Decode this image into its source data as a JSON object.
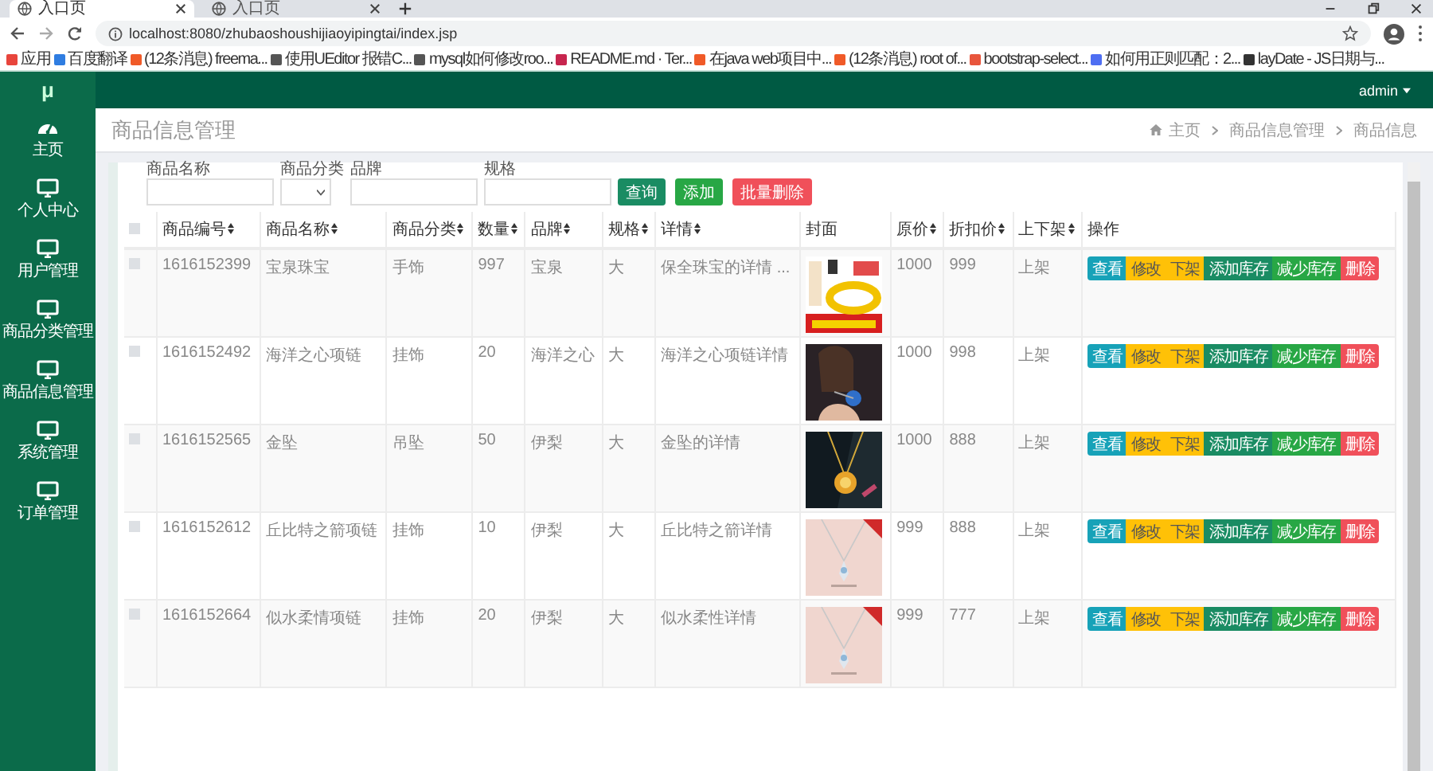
{
  "browser": {
    "tabs": [
      {
        "title": "入口页",
        "selected": true
      },
      {
        "title": "入口页",
        "selected": false
      }
    ],
    "url": "localhost:8080/zhubaoshoushijiaoyipingtai/index.jsp",
    "bookmarks": [
      {
        "label": "应用",
        "color": "#e8453c"
      },
      {
        "label": "百度翻译",
        "color": "#2f7de1"
      },
      {
        "label": "(12条消息) freema...",
        "color": "#f05a28"
      },
      {
        "label": "使用UEditor 报错C...",
        "color": "#555555"
      },
      {
        "label": "mysql如何修改roo...",
        "color": "#555555"
      },
      {
        "label": "README.md · Ter...",
        "color": "#c7254e"
      },
      {
        "label": "在java web项目中...",
        "color": "#f05a28"
      },
      {
        "label": "(12条消息) root of...",
        "color": "#f05a28"
      },
      {
        "label": "bootstrap-select...",
        "color": "#e8553c"
      },
      {
        "label": "如何用正则匹配：2...",
        "color": "#4e6ef2"
      },
      {
        "label": "layDate - JS日期与...",
        "color": "#333333"
      }
    ]
  },
  "app": {
    "logo": "μ",
    "user": "admin",
    "sidebar": [
      {
        "label": "主页",
        "kind": "gauge"
      },
      {
        "label": "个人中心",
        "kind": "monitor"
      },
      {
        "label": "用户管理",
        "kind": "monitor"
      },
      {
        "label": "商品分类管理",
        "kind": "monitor"
      },
      {
        "label": "商品信息管理",
        "kind": "monitor"
      },
      {
        "label": "系统管理",
        "kind": "monitor"
      },
      {
        "label": "订单管理",
        "kind": "monitor"
      }
    ],
    "page_title": "商品信息管理",
    "breadcrumb": [
      "主页",
      "商品信息管理",
      "商品信息"
    ],
    "filters": [
      {
        "label": "商品名称",
        "kind": "input"
      },
      {
        "label": "商品分类",
        "kind": "select"
      },
      {
        "label": "品牌",
        "kind": "input"
      },
      {
        "label": "规格",
        "kind": "input"
      }
    ],
    "filter_buttons": [
      {
        "label": "查询",
        "kind": "query"
      },
      {
        "label": "添加",
        "kind": "add"
      },
      {
        "label": "批量删除",
        "kind": "delete"
      }
    ],
    "table": {
      "select_all_checked": false,
      "columns": [
        {
          "label": "商品编号",
          "sortable": true
        },
        {
          "label": "商品名称",
          "sortable": true
        },
        {
          "label": "商品分类",
          "sortable": true
        },
        {
          "label": "数量",
          "sortable": true
        },
        {
          "label": "品牌",
          "sortable": true
        },
        {
          "label": "规格",
          "sortable": true
        },
        {
          "label": "详情",
          "sortable": true
        },
        {
          "label": "封面",
          "sortable": false
        },
        {
          "label": "原价",
          "sortable": true
        },
        {
          "label": "折扣价",
          "sortable": true
        },
        {
          "label": "上下架",
          "sortable": true
        },
        {
          "label": "操作",
          "sortable": false
        }
      ],
      "rows": [
        {
          "checked": false,
          "cells": [
            "1616152399",
            "宝泉珠宝",
            "手饰",
            "997",
            "宝泉",
            "大",
            "保全珠宝的详情 ..."
          ],
          "cover": {
            "kind": "picture"
          },
          "prices": [
            "1000",
            "999",
            "上架"
          ],
          "actions": [
            "查看",
            "修改",
            "下架",
            "添加库存",
            "减少库存",
            "删除"
          ]
        },
        {
          "checked": false,
          "cells": [
            "1616152492",
            "海洋之心项链",
            "挂饰",
            "20",
            "海洋之心",
            "大",
            "海洋之心项链详情"
          ],
          "cover": {
            "kind": "picture"
          },
          "prices": [
            "1000",
            "998",
            "上架"
          ],
          "actions": [
            "查看",
            "修改",
            "下架",
            "添加库存",
            "减少库存",
            "删除"
          ]
        },
        {
          "checked": false,
          "cells": [
            "1616152565",
            "金坠",
            "吊坠",
            "50",
            "伊梨",
            "大",
            "金坠的详情"
          ],
          "cover": {
            "kind": "picture"
          },
          "prices": [
            "1000",
            "888",
            "上架"
          ],
          "actions": [
            "查看",
            "修改",
            "下架",
            "添加库存",
            "减少库存",
            "删除"
          ]
        },
        {
          "checked": false,
          "cells": [
            "1616152612",
            "丘比特之箭项链",
            "挂饰",
            "10",
            "伊梨",
            "大",
            "丘比特之箭详情"
          ],
          "cover": {
            "kind": "picture"
          },
          "prices": [
            "999",
            "888",
            "上架"
          ],
          "actions": [
            "查看",
            "修改",
            "下架",
            "添加库存",
            "减少库存",
            "删除"
          ]
        },
        {
          "checked": false,
          "cells": [
            "1616152664",
            "似水柔情项链",
            "挂饰",
            "20",
            "伊梨",
            "大",
            "似水柔性详情"
          ],
          "cover": {
            "kind": "picture"
          },
          "prices": [
            "999",
            "777",
            "上架"
          ],
          "actions": [
            "查看",
            "修改",
            "下架",
            "添加库存",
            "减少库存",
            "删除"
          ]
        }
      ]
    }
  }
}
